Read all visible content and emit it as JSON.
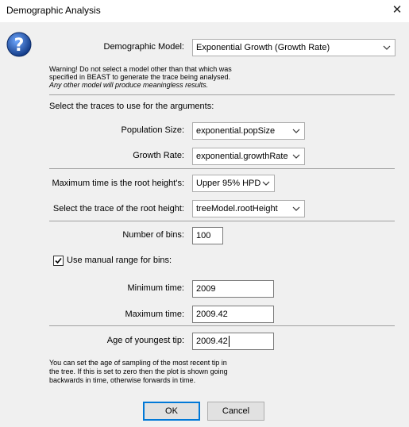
{
  "window": {
    "title": "Demographic Analysis",
    "close_glyph": "✕"
  },
  "icons": {
    "help": "help-question-icon"
  },
  "demographic_model": {
    "label": "Demographic Model:",
    "value": "Exponential Growth (Growth Rate)"
  },
  "warning": {
    "line1": "Warning! Do not select a model other than that which was",
    "line2": "specified in BEAST to generate the trace being analysed.",
    "line3": "Any other model will produce meaningless results."
  },
  "traces_heading": "Select the traces to use for the arguments:",
  "population_size": {
    "label": "Population Size:",
    "value": "exponential.popSize"
  },
  "growth_rate": {
    "label": "Growth Rate:",
    "value": "exponential.growthRate"
  },
  "max_time": {
    "label": "Maximum time is the root height's:",
    "value": "Upper 95% HPD"
  },
  "root_height": {
    "label": "Select the trace of the root height:",
    "value": "treeModel.rootHeight"
  },
  "bins": {
    "label": "Number of bins:",
    "value": "100"
  },
  "manual_range": {
    "label": "Use manual range for bins:",
    "checked": true
  },
  "min_time": {
    "label": "Minimum time:",
    "value": "2009"
  },
  "max_time_field": {
    "label": "Maximum time:",
    "value": "2009.42"
  },
  "youngest_tip": {
    "label": "Age of youngest tip:",
    "value": "2009.42"
  },
  "note": {
    "line1": "You can set the age of sampling of the most recent tip in",
    "line2": "the tree. If this is set to zero then the plot is shown going",
    "line3": "backwards in time, otherwise forwards in time."
  },
  "buttons": {
    "ok": "OK",
    "cancel": "Cancel"
  },
  "colors": {
    "accent": "#0078d7",
    "background": "#f0f0f0",
    "icon_blue": "#1c4e9c"
  }
}
